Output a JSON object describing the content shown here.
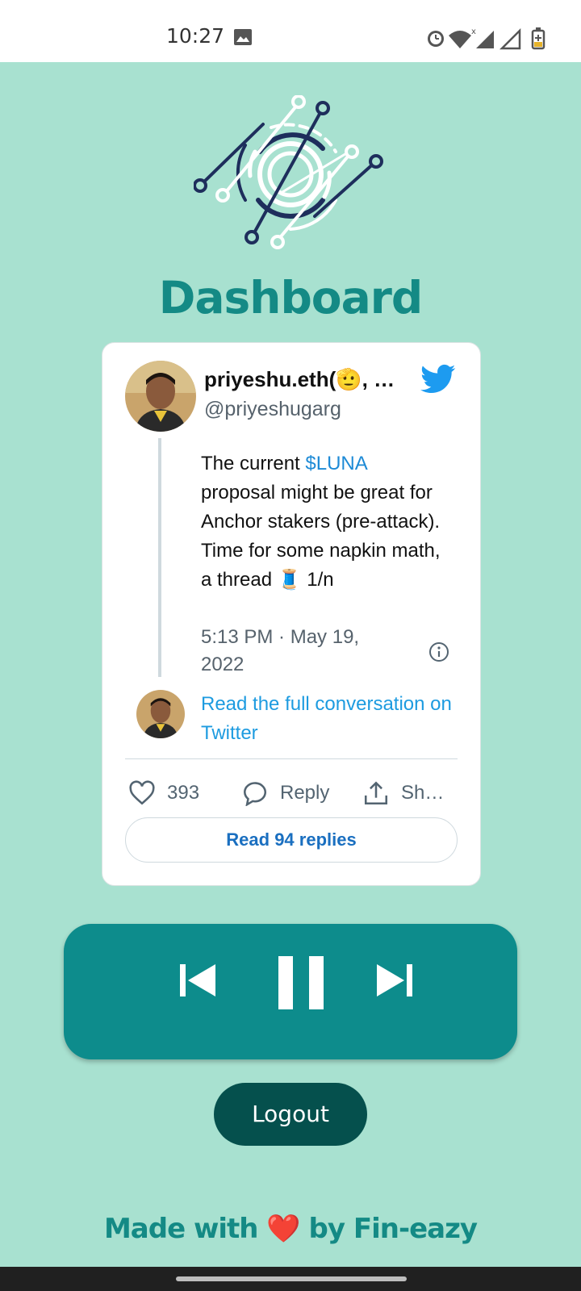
{
  "status_bar": {
    "time": "10:27"
  },
  "app": {
    "title": "Dashboard",
    "footer": {
      "before": "Made with",
      "heart": "❤️",
      "after": "by Fin-eazy"
    },
    "logout_label": "Logout"
  },
  "tweet": {
    "author_name": "priyeshu.eth(🫡, …",
    "handle": "@priyeshugarg",
    "text_before": "The current ",
    "cashtag": "$LUNA",
    "text_after": " proposal might be great for Anchor stakers (pre-attack).  Time for some napkin math, a thread 🧵 1/n",
    "timestamp": "5:13 PM · May 19, 2022",
    "read_full": "Read the full conversation on Twitter",
    "likes": "393",
    "reply_label": "Reply",
    "share_label": "Sh…",
    "read_replies": "Read 94 replies",
    "colors": {
      "link": "#1d9be0",
      "twitter_blue": "#1d9bf0"
    }
  },
  "player": {
    "controls": [
      "skip-previous-icon",
      "pause-icon",
      "skip-next-icon"
    ]
  },
  "colors": {
    "background": "#a8e1d0",
    "accent": "#148a85",
    "player": "#0d8c8c",
    "logout": "#05504d"
  }
}
